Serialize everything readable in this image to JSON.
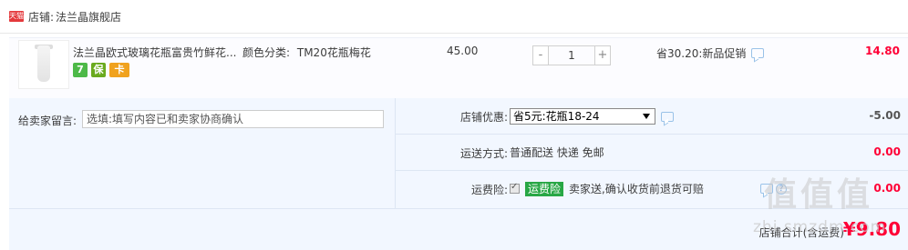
{
  "shop": {
    "badge": "天猫",
    "label": "店铺:",
    "name": "法兰晶旗舰店"
  },
  "item": {
    "title": "法兰晶欧式玻璃花瓶富贵竹鲜花...",
    "sku_label": "颜色分类:",
    "sku_value": "TM20花瓶梅花",
    "service_badges": [
      "7",
      "保",
      "卡"
    ],
    "price": "45.00",
    "qty_minus": "-",
    "quantity": "1",
    "qty_plus": "+",
    "promo_note": "省30.20:新品促销",
    "subtotal": "14.80"
  },
  "message": {
    "label": "给卖家留言:",
    "placeholder": "选填:填写内容已和卖家协商确认"
  },
  "discount": {
    "label": "店铺优惠:",
    "selected": "省5元:花瓶18-24",
    "amount": "-5.00"
  },
  "shipping": {
    "label": "运送方式:",
    "method": "普通配送 快递 免邮",
    "amount": "0.00"
  },
  "insurance": {
    "label": "运费险:",
    "tag": "运费险",
    "desc": "卖家送,确认收货前退货可赔",
    "amount": "0.00",
    "help": "?"
  },
  "total": {
    "label": "店铺合计(含运费)",
    "amount": "¥9.80"
  },
  "watermark": {
    "glyphs": "值值值",
    "url": "zhi.smzdm.com"
  },
  "colors": {
    "accent_red": "#ff0036",
    "tmall_red": "#e4393c",
    "panel_bg": "#f2f7ff",
    "insurance_green": "#28a745"
  }
}
